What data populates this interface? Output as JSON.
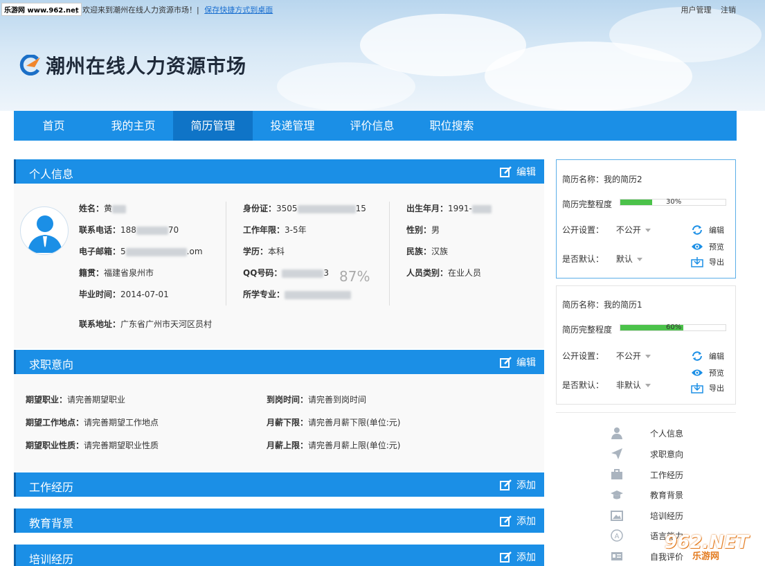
{
  "topbar": {
    "site_tag": "乐游网 www.962.net",
    "welcome": "，欢迎来到潮州在线人力资源市场！|",
    "shortcut_link": "保存快捷方式到桌面",
    "user_manage": "用户管理",
    "logout": "注销"
  },
  "logo": {
    "title": "潮州在线人力资源市场"
  },
  "nav": [
    "首页",
    "我的主页",
    "简历管理",
    "投递管理",
    "评价信息",
    "职位搜索"
  ],
  "personal": {
    "title": "个人信息",
    "edit": "编辑",
    "col1": [
      {
        "label": "姓名：",
        "value": "黄"
      },
      {
        "label": "联系电话：",
        "value": "188",
        "tail": "70"
      },
      {
        "label": "电子邮箱：",
        "value": "5",
        "tail": ".om"
      },
      {
        "label": "籍贯：",
        "value": "福建省泉州市"
      },
      {
        "label": "毕业时间：",
        "value": "2014-07-01"
      }
    ],
    "col2": [
      {
        "label": "身份证：",
        "value": "3505",
        "tail": "15"
      },
      {
        "label": "工作年限：",
        "value": "3-5年"
      },
      {
        "label": "学历：",
        "value": "本科"
      },
      {
        "label": "QQ号码：",
        "value": "",
        "tail": "3"
      },
      {
        "label": "所学专业：",
        "value": ""
      }
    ],
    "col3": [
      {
        "label": "出生年月：",
        "value": "1991-"
      },
      {
        "label": "性别：",
        "value": "男"
      },
      {
        "label": "民族：",
        "value": "汉族"
      },
      {
        "label": "人员类别：",
        "value": "在业人员"
      }
    ],
    "percent_overlay": "87%",
    "address_label": "联系地址：",
    "address_value": "广东省广州市天河区员村"
  },
  "intent": {
    "title": "求职意向",
    "edit": "编辑",
    "left": [
      {
        "label": "期望职业：",
        "value": "请完善期望职业"
      },
      {
        "label": "期望工作地点：",
        "value": "请完善期望工作地点"
      },
      {
        "label": "期望职业性质：",
        "value": "请完善期望职业性质"
      }
    ],
    "right": [
      {
        "label": "到岗时间：",
        "value": "请完善到岗时间"
      },
      {
        "label": "月薪下限：",
        "value": "请完善月薪下限(单位:元)"
      },
      {
        "label": "月薪上限：",
        "value": "请完善月薪上限(单位:元)"
      }
    ]
  },
  "work": {
    "title": "工作经历",
    "add": "添加"
  },
  "education": {
    "title": "教育背景",
    "add": "添加"
  },
  "training": {
    "title": "培训经历",
    "add": "添加"
  },
  "resumes": [
    {
      "name": "简历名称：我的简历2",
      "completeness_label": "简历完整程度",
      "completeness": 30,
      "completeness_text": "30%",
      "public_label": "公开设置：",
      "public_value": "不公开",
      "default_label": "是否默认：",
      "default_value": "默认",
      "edit": "编辑",
      "preview": "预览",
      "export": "导出"
    },
    {
      "name": "简历名称：我的简历1",
      "completeness_label": "简历完整程度",
      "completeness": 60,
      "completeness_text": "60%",
      "public_label": "公开设置：",
      "public_value": "不公开",
      "default_label": "是否默认：",
      "default_value": "非默认",
      "edit": "编辑",
      "preview": "预览",
      "export": "导出"
    }
  ],
  "side_nav": [
    "个人信息",
    "求职意向",
    "工作经历",
    "教育背景",
    "培训经历",
    "语言能力",
    "自我评价"
  ],
  "watermark": {
    "main": "962.NET",
    "sub": "乐游网"
  },
  "colors": {
    "nav_blue": "#1b8fe6",
    "nav_active": "#0f74c7",
    "progress_green": "#4bc24a"
  }
}
